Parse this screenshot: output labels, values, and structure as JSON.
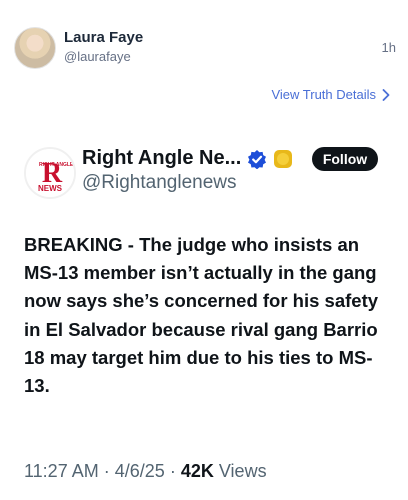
{
  "truth": {
    "name": "Laura Faye",
    "handle": "@laurafaye",
    "time": "1h",
    "view_details": "View Truth Details"
  },
  "tweet": {
    "display_name": "Right Angle Ne...",
    "handle": "@Rightanglenews",
    "follow_label": "Follow",
    "text": "BREAKING - The judge who insists an MS-13 member isn’t actually in the gang now says she’s concerned for his safety in El Salvador because rival gang Barrio 18 may target him due to his ties to MS-13.",
    "time": "11:27 AM",
    "date": "4/6/25",
    "views_count": "42K",
    "views_label": "Views",
    "separator": "·"
  },
  "logo": {
    "letter": "R",
    "small_text": "RIGHT ANGLE",
    "word": "NEWS"
  },
  "colors": {
    "link": "#4a6fd6",
    "verified": "#1d4ed8",
    "gold": "#e8b81a",
    "logo_red": "#c8102e",
    "follow_bg": "#0f1419"
  },
  "icons": [
    "chevron-right-icon",
    "verified-badge-icon",
    "gold-badge-icon"
  ]
}
